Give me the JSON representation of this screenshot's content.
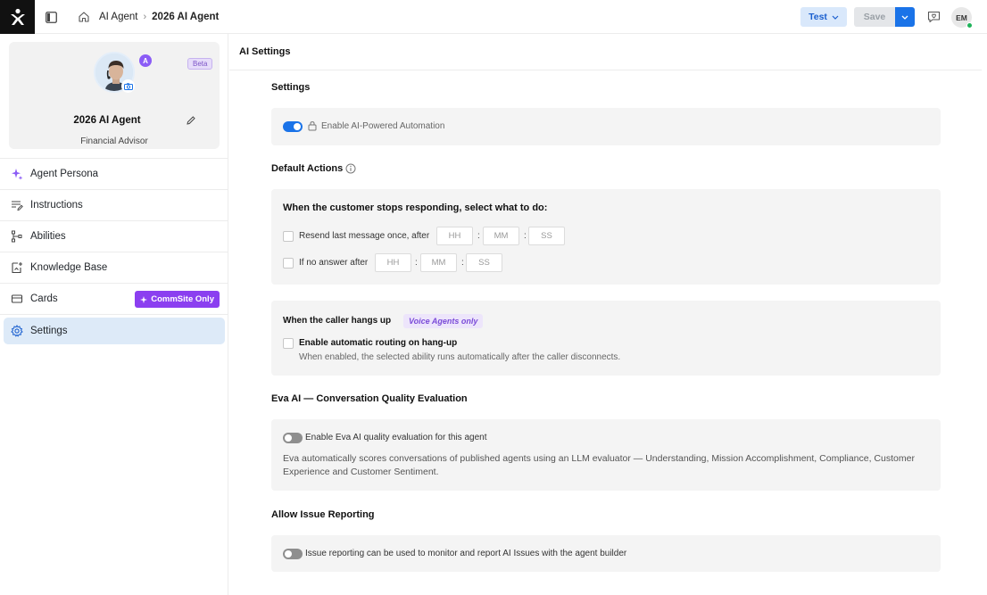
{
  "topbar": {
    "breadcrumb": [
      "AI Agent",
      "2026 AI Agent"
    ],
    "test_label": "Test",
    "save_label": "Save",
    "user_initials": "EM"
  },
  "agent": {
    "beta_label": "Beta",
    "name": "2026 AI Agent",
    "role": "Financial Advisor"
  },
  "nav": {
    "items": [
      {
        "label": "Agent Persona"
      },
      {
        "label": "Instructions"
      },
      {
        "label": "Abilities"
      },
      {
        "label": "Knowledge Base"
      },
      {
        "label": "Cards"
      },
      {
        "label": "Settings"
      }
    ],
    "commsite_badge": "CommSite Only"
  },
  "main": {
    "header": "AI Settings",
    "settings": {
      "title": "Settings",
      "automation_label": "Enable AI-Powered Automation",
      "automation_enabled": true
    },
    "default_actions": {
      "title": "Default Actions",
      "prompt": "When the customer stops responding, select what to do:",
      "resend_label": "Resend last message once, after",
      "no_answer_label": "If no answer after",
      "hh_placeholder": "HH",
      "mm_placeholder": "MM",
      "ss_placeholder": "SS"
    },
    "hangup": {
      "title": "When the caller hangs up",
      "voice_badge": "Voice Agents only",
      "routing_label": "Enable automatic routing on hang-up",
      "routing_desc": "When enabled, the selected ability runs automatically after the caller disconnects."
    },
    "eva": {
      "title": "Eva AI — Conversation Quality Evaluation",
      "toggle_label": "Enable Eva AI quality evaluation for this agent",
      "enabled": false,
      "description": "Eva automatically scores conversations of published agents using an LLM evaluator — Understanding, Mission Accomplishment, Compliance, Customer Experience and Customer Sentiment."
    },
    "issue_reporting": {
      "title": "Allow Issue Reporting",
      "toggle_label": "Issue reporting can be used to monitor and report AI Issues with the agent builder",
      "enabled": false
    }
  }
}
